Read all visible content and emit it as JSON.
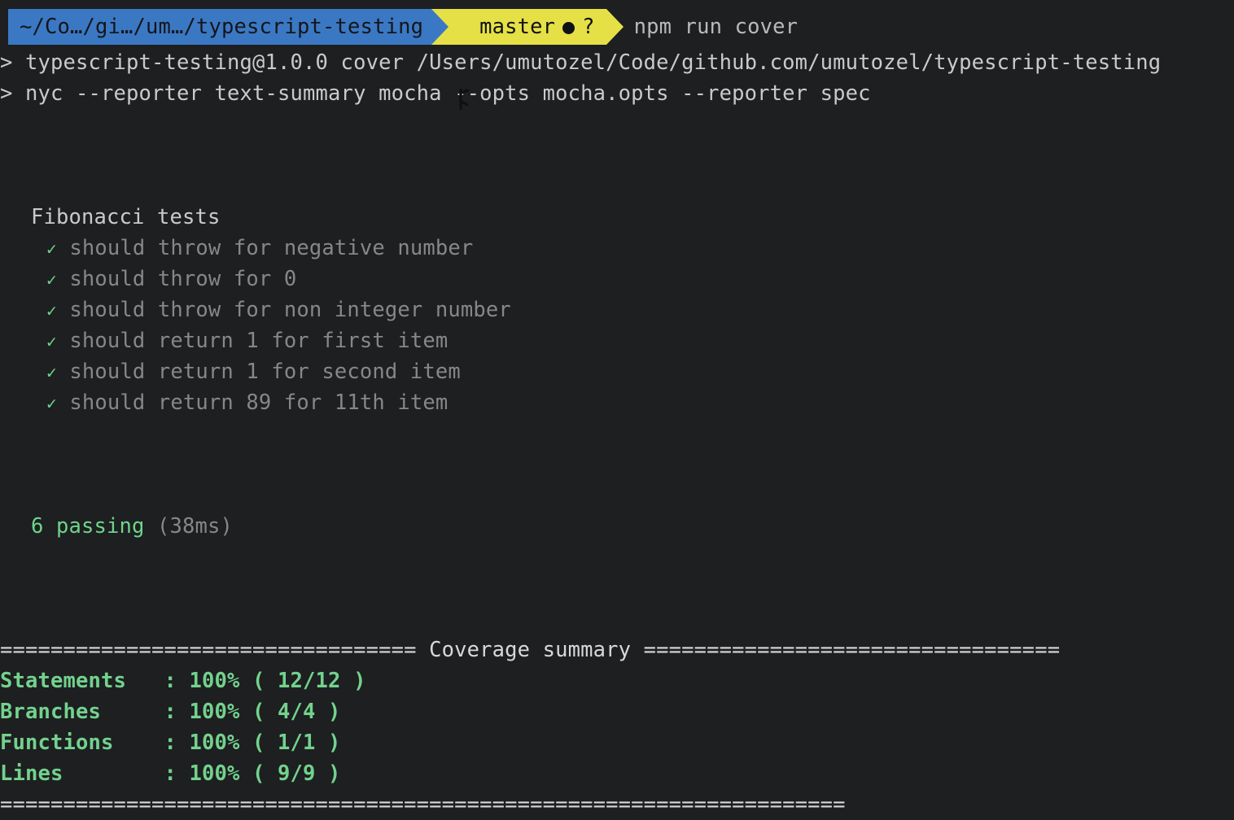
{
  "terminal": {
    "background_color": "#1d1f21",
    "foreground_color": "#c9cacb",
    "dim_color": "#868789",
    "green_color": "#6fd48a"
  },
  "prompt": {
    "path_segment": {
      "text": "~/Co…/gi…/um…/typescript-testing",
      "background_color": "#3b78c4",
      "text_color": "#14161a"
    },
    "git_segment": {
      "branch": "master",
      "dirty_indicator": "●",
      "untracked_indicator": "?",
      "background_color": "#e5e046",
      "text_color": "#101114",
      "icon": "git-branch-icon"
    },
    "command": "npm run cover"
  },
  "npm_output": {
    "line1": "> typescript-testing@1.0.0 cover /Users/umutozel/Code/github.com/umutozel/typescript-testing",
    "line2": "> nyc --reporter text-summary mocha --opts mocha.opts --reporter spec"
  },
  "mocha": {
    "suite_title": "Fibonacci tests",
    "check_glyph": "✓",
    "tests": [
      "should throw for negative number",
      "should throw for 0",
      "should throw for non integer number",
      "should return 1 for first item",
      "should return 1 for second item",
      "should return 89 for 11th item"
    ],
    "summary_count": "6 passing",
    "summary_duration": "(38ms)"
  },
  "coverage": {
    "header_rule_left": "=================================",
    "header_title": "Coverage summary",
    "header_rule_right": "=================================",
    "footer_rule": "===================================================================",
    "rows": [
      {
        "label": "Statements",
        "separator": ":",
        "percent": "100%",
        "ratio": "( 12/12 )"
      },
      {
        "label": "Branches",
        "separator": ":",
        "percent": "100%",
        "ratio": "( 4/4 )"
      },
      {
        "label": "Functions",
        "separator": ":",
        "percent": "100%",
        "ratio": "( 1/1 )"
      },
      {
        "label": "Lines",
        "separator": ":",
        "percent": "100%",
        "ratio": "( 9/9 )"
      }
    ],
    "line_statements": "Statements   : 100% ( 12/12 )",
    "line_branches": "Branches     : 100% ( 4/4 )",
    "line_functions": "Functions    : 100% ( 1/1 )",
    "line_lines": "Lines        : 100% ( 9/9 )",
    "header_line": "================================= Coverage summary ================================="
  }
}
